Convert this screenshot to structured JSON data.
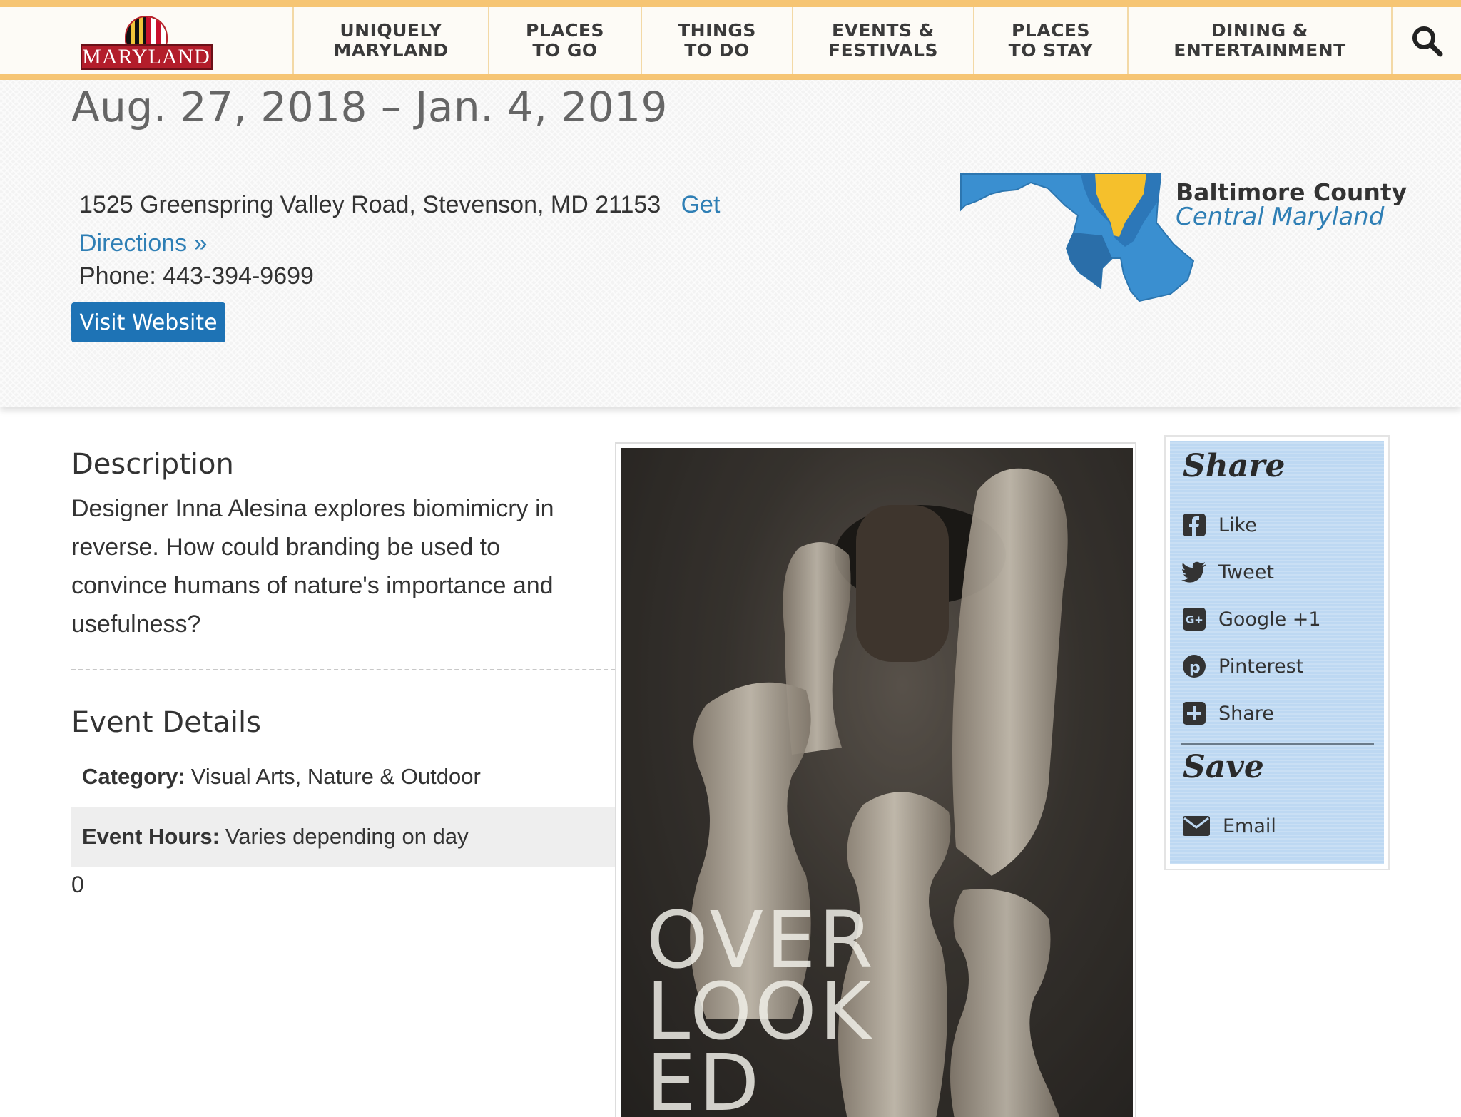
{
  "nav": {
    "logo_text": "MARYLAND",
    "items": [
      {
        "label": "UNIQUELY\nMARYLAND"
      },
      {
        "label": "PLACES\nTO GO"
      },
      {
        "label": "THINGS\nTO DO"
      },
      {
        "label": "EVENTS &\nFESTIVALS"
      },
      {
        "label": "PLACES\nTO STAY"
      },
      {
        "label": "DINING &\nENTERTAINMENT"
      }
    ],
    "search_icon": "search-icon"
  },
  "event": {
    "date_range": "Aug. 27, 2018 – Jan. 4, 2019",
    "address": "1525 Greenspring Valley Road, Stevenson, MD 21153",
    "directions_label": "Get Directions »",
    "phone": "Phone: 443-394-9699",
    "visit_label": "Visit Website",
    "county": "Baltimore County",
    "region": "Central Maryland"
  },
  "description": {
    "heading": "Description",
    "text": "Designer Inna Alesina explores biomimicry in reverse. How could branding be used to convince humans of nature's importance and usefulness?"
  },
  "details": {
    "heading": "Event Details",
    "category_key": "Category:",
    "category_value": "Visual Arts, Nature & Outdoor",
    "hours_key": "Event Hours:",
    "hours_value": "Varies depending on day",
    "extra": "0"
  },
  "poster": {
    "title_text": "OVER\nLOOK\n    ED"
  },
  "share": {
    "heading": "Share",
    "items": [
      {
        "label": "Like",
        "icon": "facebook-icon"
      },
      {
        "label": "Tweet",
        "icon": "twitter-icon"
      },
      {
        "label": "Google +1",
        "icon": "google-plus-icon"
      },
      {
        "label": "Pinterest",
        "icon": "pinterest-icon"
      },
      {
        "label": "Share",
        "icon": "plus-share-icon"
      }
    ],
    "save_heading": "Save",
    "email_label": "Email"
  },
  "colors": {
    "accent_gold": "#f6c574",
    "link_blue": "#2f7fb5",
    "button_blue": "#1e73b5",
    "map_blue": "#3a8fd0",
    "map_highlight": "#f5c02c"
  }
}
